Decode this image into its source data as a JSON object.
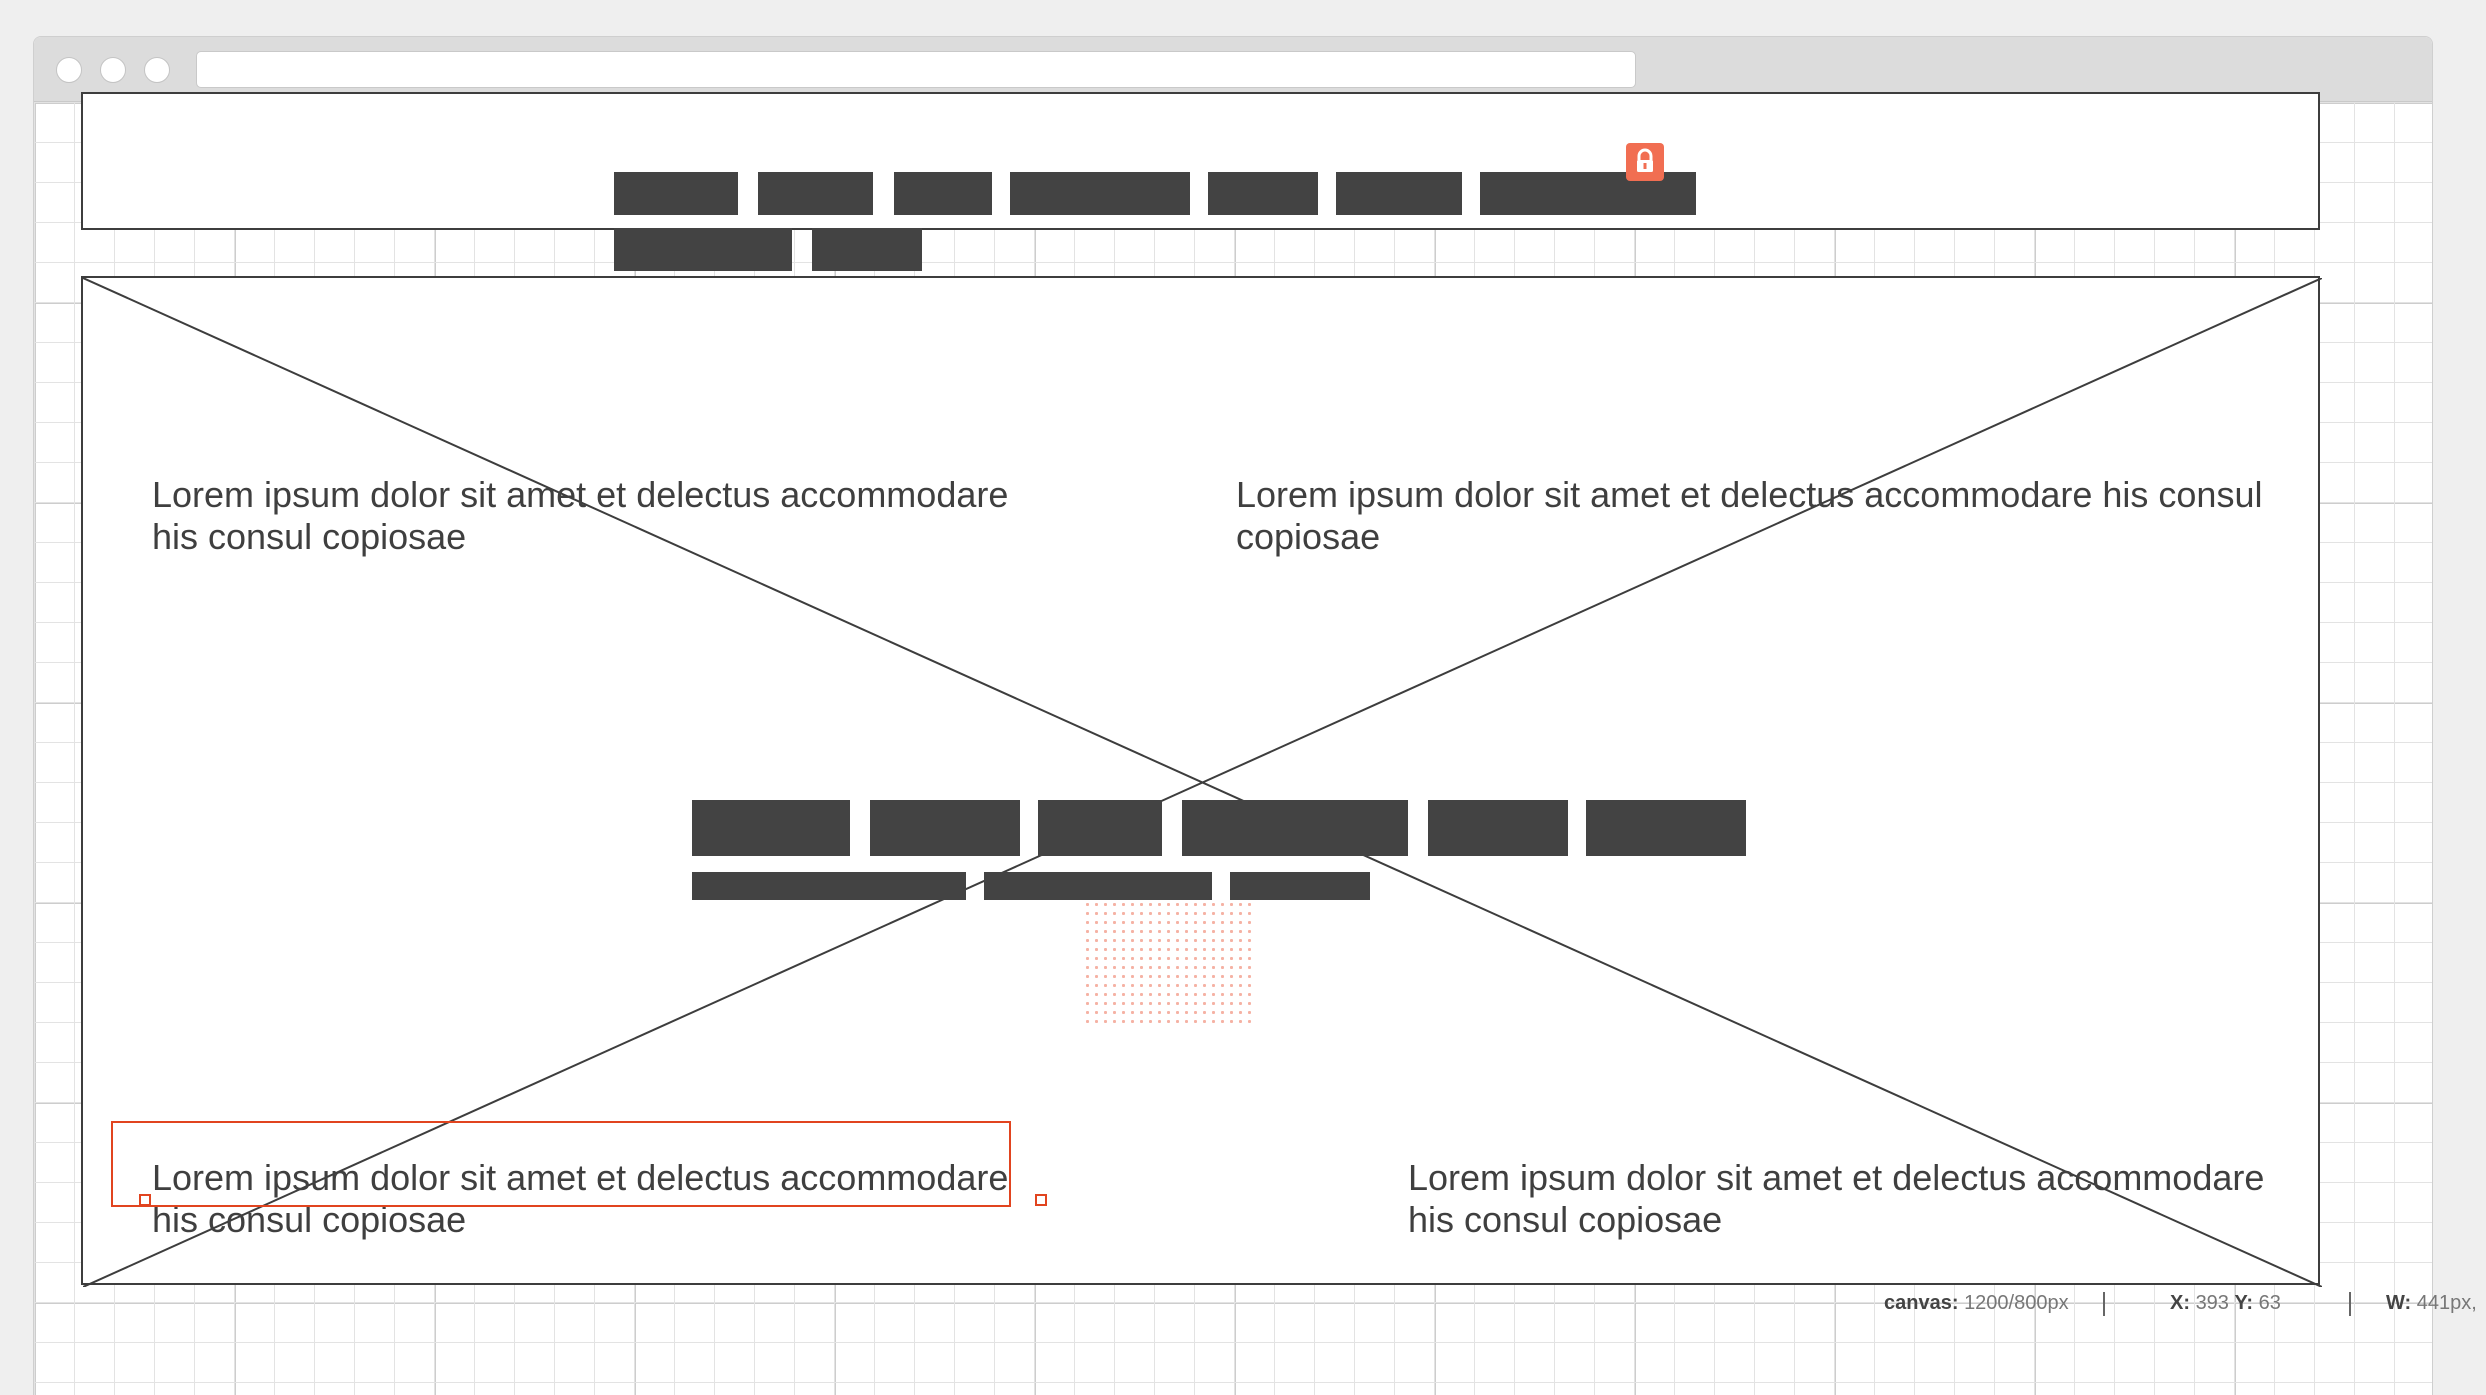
{
  "browser": {
    "window_buttons": [
      "close",
      "minimize",
      "maximize"
    ],
    "address_value": ""
  },
  "colors": {
    "block": "#434343",
    "accent": "#f16e52",
    "selection": "#e1441f",
    "outline": "#3d3d3d"
  },
  "header": {
    "nav_row1_count": 7,
    "nav_row2_count": 2,
    "lock_icon": "lock-icon"
  },
  "main": {
    "placeholder": "image-placeholder-x",
    "paragraphs": [
      "Lorem ipsum dolor sit amet et delectus accommodare his consul copiosae",
      "Lorem ipsum dolor sit amet et delectus accommodare his consul copiosae",
      "Lorem ipsum dolor sit amet et delectus accommodare his consul copiosae",
      "Lorem ipsum dolor sit amet et delectus accommodare his consul copiosae"
    ]
  },
  "statusbar": {
    "canvas_label": "canvas:",
    "canvas_value": "1200/800px",
    "x_label": "X:",
    "x_value": "393",
    "y_label": "Y:",
    "y_value": "63",
    "w_label": "W:",
    "w_value": "441px,"
  }
}
